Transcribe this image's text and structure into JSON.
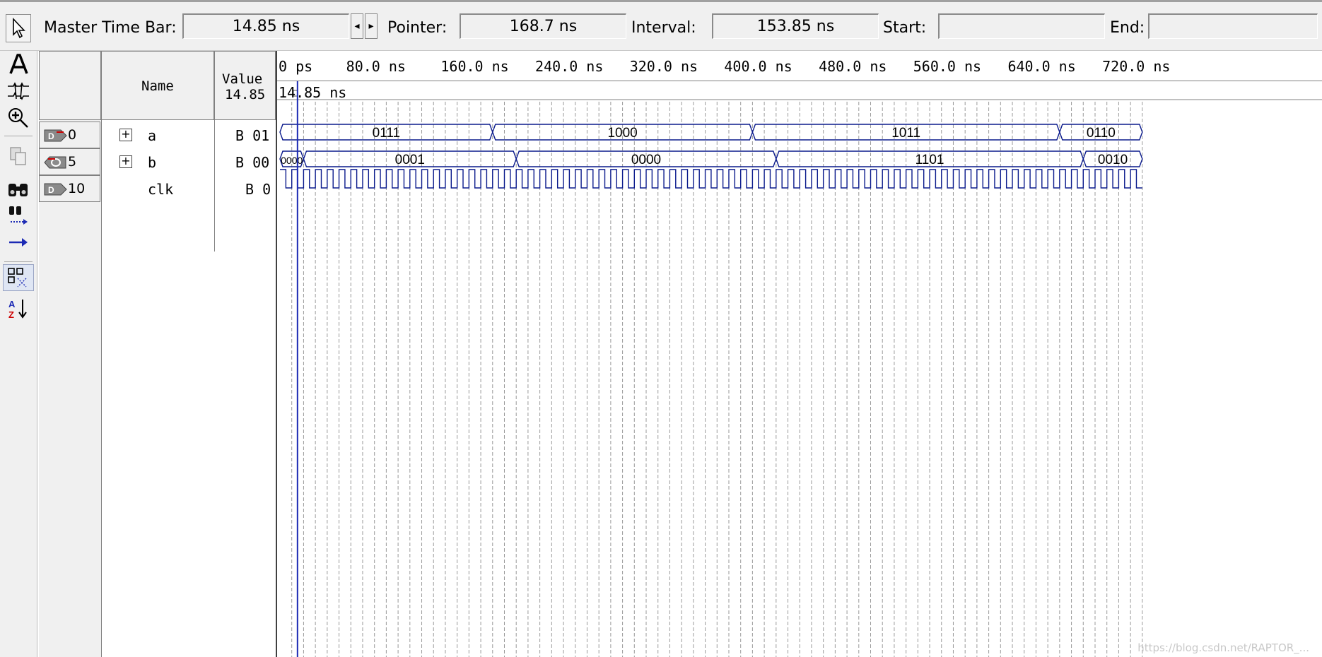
{
  "toolbar": {
    "master_time_bar_label": "Master Time Bar:",
    "master_time_bar_value": "14.85 ns",
    "pointer_label": "Pointer:",
    "pointer_value": "168.7 ns",
    "interval_label": "Interval:",
    "interval_value": "153.85 ns",
    "start_label": "Start:",
    "start_value": "",
    "end_label": "End:",
    "end_value": ""
  },
  "palette": {
    "tools": [
      "selection-tool-icon",
      "text-tool-icon",
      "waveform-editing-icon",
      "zoom-icon",
      "copy-icon",
      "find-icon",
      "replace-icon",
      "next-transition-icon",
      "snap-to-grid-icon",
      "sort-icon"
    ]
  },
  "grid": {
    "name_header": "Name",
    "value_header": "Value",
    "value_header_time": "14.85",
    "rows": [
      {
        "index": "0",
        "name": "a",
        "value": "B 01",
        "expandable": true
      },
      {
        "index": "5",
        "name": "b",
        "value": "B 00",
        "expandable": true
      },
      {
        "index": "10",
        "name": "clk",
        "value": "B 0",
        "expandable": false
      }
    ]
  },
  "waveform": {
    "master_time_bar_marker": "14.85 ns",
    "time_axis_ns": [
      0,
      80,
      160,
      240,
      320,
      400,
      480,
      560,
      640,
      720
    ],
    "tick_labels": [
      "0 ps",
      "80.0 ns",
      "160.0 ns",
      "240.0 ns",
      "320.0 ns",
      "400.0 ns",
      "480.0 ns",
      "560.0 ns",
      "640.0 ns",
      "720.0 ns"
    ],
    "signals": {
      "a": [
        {
          "start": 0,
          "end": 180,
          "value": "0111"
        },
        {
          "start": 180,
          "end": 400,
          "value": "1000"
        },
        {
          "start": 400,
          "end": 660,
          "value": "1011"
        },
        {
          "start": 660,
          "end": 730,
          "value": "0110"
        }
      ],
      "b": [
        {
          "start": 0,
          "end": 20,
          "value": "0000"
        },
        {
          "start": 20,
          "end": 200,
          "value": "0001"
        },
        {
          "start": 200,
          "end": 420,
          "value": "0000"
        },
        {
          "start": 420,
          "end": 680,
          "value": "1101"
        },
        {
          "start": 680,
          "end": 730,
          "value": "0010"
        }
      ]
    },
    "clock_period_ns": 10,
    "colors": {
      "wave": "#0a1a8c",
      "cursor": "#1c2ab4",
      "grid": "#9a9a9a"
    }
  },
  "watermark": "https://blog.csdn.net/RAPTOR_..."
}
